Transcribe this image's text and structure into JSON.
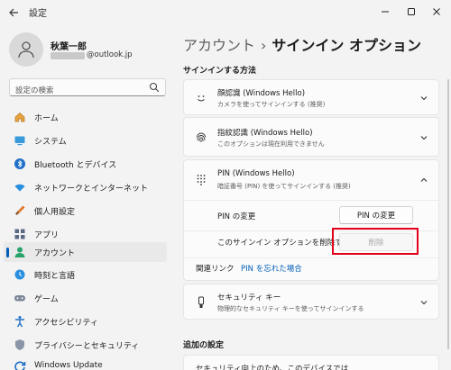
{
  "window": {
    "title": "設定",
    "back_icon": "back-arrow-icon",
    "min_icon": "minimize-icon",
    "max_icon": "maximize-icon",
    "close_icon": "close-icon"
  },
  "user": {
    "name": "秋葉一郎",
    "email_suffix": "@outlook.jp"
  },
  "search": {
    "placeholder": "設定の検索"
  },
  "sidebar": {
    "items": [
      {
        "label": "ホーム",
        "icon": "home-icon"
      },
      {
        "label": "システム",
        "icon": "system-icon"
      },
      {
        "label": "Bluetooth とデバイス",
        "icon": "bluetooth-icon"
      },
      {
        "label": "ネットワークとインターネット",
        "icon": "network-icon"
      },
      {
        "label": "個人用設定",
        "icon": "personalization-icon"
      },
      {
        "label": "アプリ",
        "icon": "apps-icon"
      },
      {
        "label": "アカウント",
        "icon": "accounts-icon",
        "active": true
      },
      {
        "label": "時刻と言語",
        "icon": "time-language-icon"
      },
      {
        "label": "ゲーム",
        "icon": "gaming-icon"
      },
      {
        "label": "アクセシビリティ",
        "icon": "accessibility-icon"
      },
      {
        "label": "プライバシーとセキュリティ",
        "icon": "privacy-shield-icon"
      },
      {
        "label": "Windows Update",
        "icon": "windows-update-icon"
      }
    ]
  },
  "main": {
    "breadcrumb_parent": "アカウント",
    "breadcrumb_sep": "›",
    "breadcrumb_current": "サインイン オプション",
    "section_signin": "サインインする方法",
    "cards": [
      {
        "title": "顔認識 (Windows Hello)",
        "sub": "カメラを使ってサインインする (推奨)",
        "icon": "face-icon",
        "expanded": false
      },
      {
        "title": "指紋認識 (Windows Hello)",
        "sub": "このオプションは現在利用できません",
        "icon": "fingerprint-icon",
        "expanded": false
      },
      {
        "title": "PIN (Windows Hello)",
        "sub": "暗証番号 (PIN) を使ってサインインする (推奨)",
        "icon": "pin-keypad-icon",
        "expanded": true
      },
      {
        "title": "セキュリティ キー",
        "sub": "物理的なセキュリティ キーを使ってサインインする",
        "icon": "security-key-icon",
        "expanded": false
      }
    ],
    "pin": {
      "change_label": "PIN の変更",
      "change_button": "PIN の変更",
      "remove_label": "このサインイン オプションを削除する",
      "remove_button": "削除"
    },
    "related": {
      "label": "関連リンク",
      "link": "PIN を忘れた場合"
    },
    "section_additional": "追加の設定",
    "additional_partial": "セキュリティ向上のため、このデバイスでは"
  },
  "colors": {
    "accent": "#005fb8",
    "highlight": "#e2001a"
  }
}
